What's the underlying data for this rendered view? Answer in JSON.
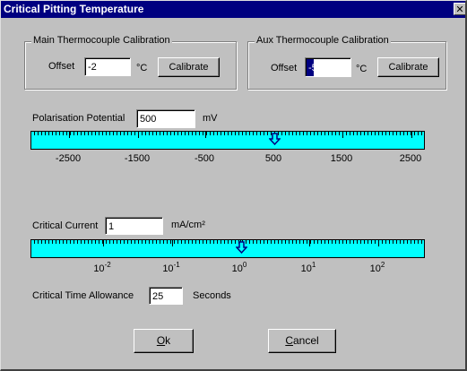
{
  "window": {
    "title": "Critical Pitting Temperature",
    "close_glyph": "✕"
  },
  "main_tc": {
    "group_label": "Main Thermocouple Calibration",
    "offset_label": "Offset",
    "offset_value": "-2",
    "unit": "°C",
    "calibrate_label": "Calibrate"
  },
  "aux_tc": {
    "group_label": "Aux Thermocouple Calibration",
    "offset_label": "Offset",
    "offset_value": "-5",
    "unit": "°C",
    "calibrate_label": "Calibrate"
  },
  "polarisation": {
    "label": "Polarisation Potential",
    "value": "500",
    "unit": "mV",
    "scale_labels": [
      "-2500",
      "-1500",
      "-500",
      "500",
      "1500",
      "2500"
    ],
    "slider_value": 500,
    "slider_min": -3200,
    "slider_max": 3300
  },
  "critical_current": {
    "label": "Critical Current",
    "value": "1",
    "unit": "mA/cm²",
    "scale_base": "10",
    "scale_exponents": [
      "-2",
      "-1",
      "0",
      "1",
      "2"
    ],
    "slider_log_value": 0
  },
  "time_allowance": {
    "label": "Critical Time Allowance",
    "value": "25",
    "unit": "Seconds"
  },
  "buttons": {
    "ok_label": "Ok",
    "ok_mnemonic": "O",
    "ok_rest": "k",
    "cancel_mnemonic": "C",
    "cancel_rest": "ancel",
    "cancel_label": "Cancel"
  },
  "colors": {
    "titlebar": "#000080",
    "slider_track": "#00ffff",
    "dialog_face": "#c0c0c0"
  },
  "icons": {
    "slider_thumb": "down-arrow-icon",
    "close": "close-icon"
  }
}
